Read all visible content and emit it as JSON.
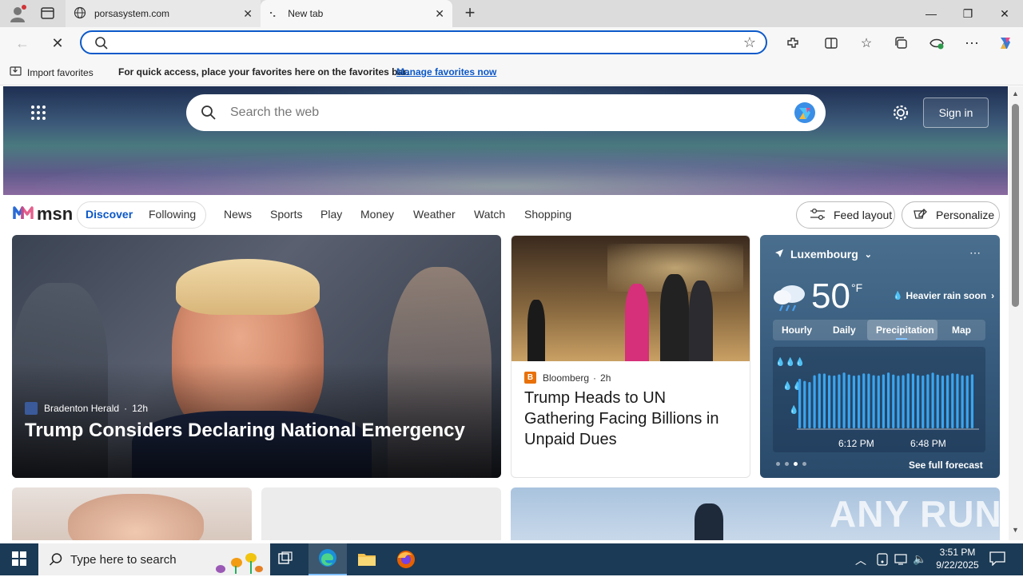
{
  "browser": {
    "tabs": [
      {
        "title": "porsasystem.com"
      },
      {
        "title": "New tab"
      }
    ],
    "new_tab_symbol": "+",
    "window_controls": {
      "minimize": "—",
      "restore": "❐",
      "close": "✕"
    }
  },
  "favorites_bar": {
    "import_label": "Import favorites",
    "message": "For quick access, place your favorites here on the favorites bar.",
    "manage_link": "Manage favorites now"
  },
  "msn": {
    "search_placeholder": "Search the web",
    "sign_in": "Sign in",
    "logo_text": "msn",
    "tabs": {
      "discover": "Discover",
      "following": "Following"
    },
    "nav": [
      "News",
      "Sports",
      "Play",
      "Money",
      "Weather",
      "Watch",
      "Shopping"
    ],
    "feed_layout": "Feed layout",
    "personalize": "Personalize"
  },
  "cards": {
    "main": {
      "source": "Bradenton Herald",
      "age": "12h",
      "headline": "Trump Considers Declaring National Emergency"
    },
    "second": {
      "source": "Bloomberg",
      "age": "2h",
      "headline": "Trump Heads to UN Gathering Facing Billions in Unpaid Dues"
    }
  },
  "weather": {
    "location": "Luxembourg",
    "temperature": "50",
    "unit": "°F",
    "alert": "Heavier rain soon",
    "tabs": [
      "Hourly",
      "Daily",
      "Precipitation",
      "Map"
    ],
    "active_tab": "Precipitation",
    "time_labels": [
      "6:12 PM",
      "6:48 PM"
    ],
    "see_forecast": "See full forecast"
  },
  "taskbar": {
    "search_placeholder": "Type here to search",
    "time": "3:51 PM",
    "date": "9/22/2025"
  },
  "watermark": "ANY RUN"
}
